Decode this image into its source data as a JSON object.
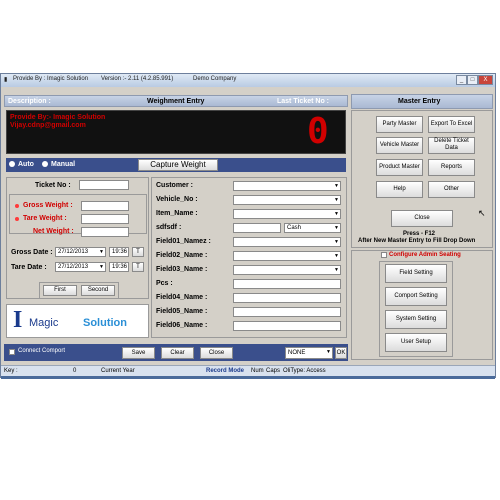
{
  "window": {
    "title": "Provide By : Imagic Solution",
    "version": "Version :- 2.11 (4.2.85.991)",
    "company": "Demo Company",
    "controls": [
      "_",
      "□",
      "X"
    ]
  },
  "header": {
    "description": "Description :",
    "weight_entry": "Weighment Entry",
    "last_ticket": "Last Ticket No :"
  },
  "display": {
    "provider_line1": "Provide By:- Imagic Solution",
    "provider_line2": "Vijay.cdnp@gmail.com",
    "reading": "0"
  },
  "mode": {
    "auto": "Auto",
    "manual": "Manual",
    "capture": "Capture Weight"
  },
  "ticket": {
    "ticket_no": "Ticket No :",
    "gross_weight": "Gross Weight :",
    "tare_weight": "Tare Weight :",
    "net_weight": "Net Weight :",
    "gross_date_label": "Gross Date :",
    "gross_date": "27/12/2013",
    "gross_time": "19:36",
    "tare_date_label": "Tare Date :",
    "tare_date": "27/12/2013",
    "tare_time": "19:36",
    "t_button": "T",
    "first": "First",
    "second": "Second"
  },
  "logo": {
    "i": "I",
    "magic": "Magic",
    "solution": "Solution"
  },
  "form": {
    "customer": "Customer :",
    "vehicle_no": "Vehicle_No :",
    "item_name": "Item_Name :",
    "sdfsdf": "sdfsdf :",
    "cash": "Cash",
    "field01": "Field01_Namez :",
    "field02": "Field02_Name :",
    "field03": "Field03_Name :",
    "pcs": "Pcs :",
    "field04": "Field04_Name :",
    "field05": "Field05_Name :",
    "field06": "Field06_Name :"
  },
  "bottom": {
    "connect_comport": "Connect Comport",
    "save": "Save",
    "clear": "Clear",
    "close": "Close",
    "none": "NONE",
    "ok": "OK"
  },
  "master": {
    "title": "Master Entry",
    "party": "Party Master",
    "export": "Export To Excel",
    "vehicle": "Vehicle Master",
    "delete_ticket": "Delete Ticket Data",
    "product": "Product Master",
    "reports": "Reports",
    "help": "Help",
    "other": "Other",
    "close": "Close",
    "note1": "Press - F12",
    "note2": "After New Master Entry to Fill Drop Down"
  },
  "admin": {
    "title": "Configure Admin Seating",
    "field_setting": "Field Setting",
    "comport_setting": "Comport Setting",
    "system_setting": "System Setting",
    "user_setup": "User Setup"
  },
  "status": {
    "key": "Key :",
    "zero": "0",
    "current_year": "Current Year",
    "record_mode": "Record Mode",
    "num": "Num",
    "caps": "Caps",
    "ovr": "OliType: Access"
  }
}
